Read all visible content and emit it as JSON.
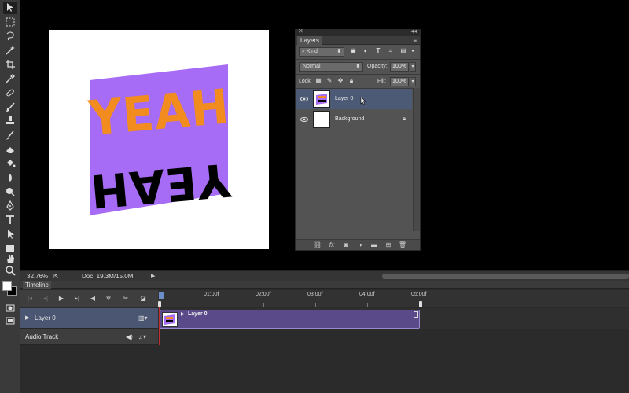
{
  "toolbar": {
    "tools": [
      "move-tool",
      "marquee-tool",
      "lasso-tool",
      "crop-tool",
      "eyedropper-tool",
      "healing-brush-tool",
      "brush-tool",
      "clone-stamp-tool",
      "history-brush-tool",
      "eraser-tool",
      "paint-bucket-tool",
      "blur-tool",
      "dodge-tool",
      "pen-tool",
      "type-tool",
      "path-selection-tool",
      "rectangle-tool",
      "hand-tool",
      "zoom-tool"
    ]
  },
  "canvas": {
    "artwork_text_top": "YEAH",
    "artwork_text_bottom": "YEAH",
    "artwork_colors": {
      "background": "#a66cf5",
      "top_text": "#f28c1e",
      "bottom_text": "#000000"
    }
  },
  "layers_panel": {
    "title": "Layers",
    "filter_kind": "Kind",
    "blend_mode": "Normal",
    "opacity_label": "Opacity:",
    "opacity_value": "100%",
    "lock_label": "Lock:",
    "fill_label": "Fill:",
    "fill_value": "100%",
    "layers": [
      {
        "name": "Layer 0",
        "selected": true
      },
      {
        "name": "Background",
        "selected": false,
        "locked": true
      }
    ]
  },
  "status_bar": {
    "zoom": "32.76%",
    "doc_info": "Doc: 19.3M/15.0M"
  },
  "timeline": {
    "tab_title": "Timeline",
    "ruler_labels": [
      "01:00f",
      "02:00f",
      "03:00f",
      "04:00f",
      "05:00f"
    ],
    "tracks": [
      {
        "name": "Layer 0",
        "clip_name": "Layer 0"
      },
      {
        "name": "Audio Track"
      }
    ],
    "clip_color": "#5a4a8a"
  }
}
